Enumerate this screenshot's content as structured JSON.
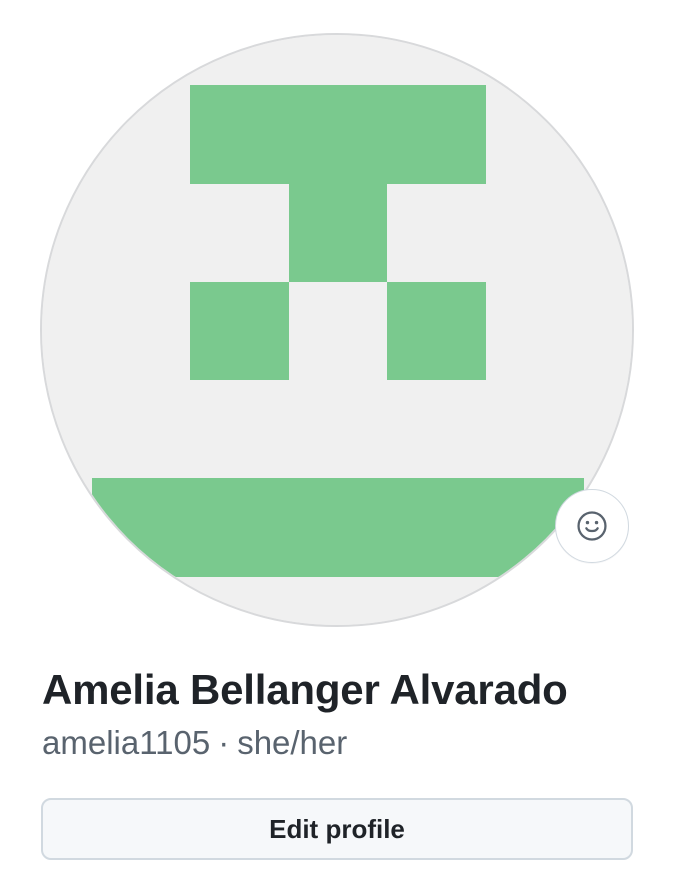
{
  "profile": {
    "full_name": "Amelia Bellanger Alvarado",
    "username": "amelia1105",
    "separator": "·",
    "pronouns": "she/her",
    "edit_label": "Edit profile"
  },
  "avatar": {
    "kind": "identicon",
    "foreground_color": "#7ac98e",
    "background_color": "#f0f0f0",
    "border_color": "#d8d9db"
  },
  "status": {
    "icon": "smiley-icon"
  },
  "colors": {
    "text_primary": "#1f2328",
    "text_secondary": "#59636e",
    "button_bg": "#f6f8fa",
    "button_border": "#d1d9e0"
  }
}
